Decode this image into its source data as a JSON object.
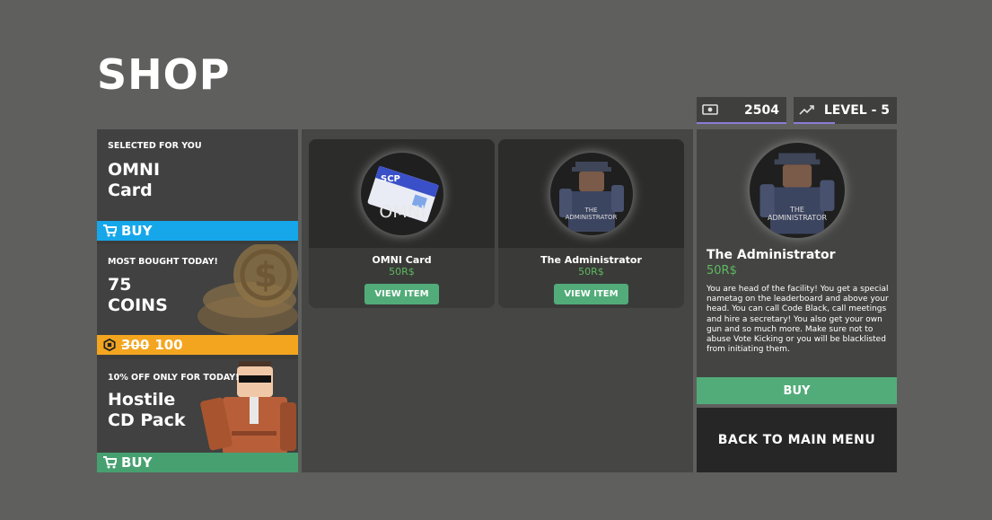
{
  "header": {
    "title": "SHOP"
  },
  "stats": {
    "currency": "2504",
    "level": "LEVEL - 5",
    "currency_icon": "cash-icon",
    "level_icon": "trend-up-icon"
  },
  "promos": [
    {
      "tag": "SELECTED FOR YOU",
      "name_line1": "OMNI",
      "name_line2": "Card",
      "action": "BUY",
      "color": "#16a7ea"
    },
    {
      "tag": "MOST BOUGHT TODAY!",
      "name_line1": "75",
      "name_line2": "COINS",
      "old_price": "300",
      "new_price": "100",
      "color": "#f4a520"
    },
    {
      "tag": "10% OFF ONLY FOR TODAY!",
      "name_line1": "Hostile",
      "name_line2": "CD Pack",
      "action": "BUY",
      "color": "#47a070"
    }
  ],
  "items": [
    {
      "name": "OMNI Card",
      "price": "50R$",
      "button": "VIEW ITEM",
      "image_text": "OMNI",
      "card_label": "SCP"
    },
    {
      "name": "The Administrator",
      "price": "50R$",
      "button": "VIEW ITEM",
      "image_text_1": "THE",
      "image_text_2": "ADMINISTRATOR"
    }
  ],
  "detail": {
    "name": "The Administrator",
    "price": "50R$",
    "description": "You are head of the facility! You get a special nametag on the leaderboard and above your head. You can call Code Black, call meetings and hire a secretary! You also get your own gun and so much more. Make sure not to abuse Vote Kicking or you will be blacklisted from initiating them.",
    "buy": "BUY",
    "image_text_1": "THE",
    "image_text_2": "ADMINISTRATOR"
  },
  "back_button": "BACK TO MAIN MENU"
}
